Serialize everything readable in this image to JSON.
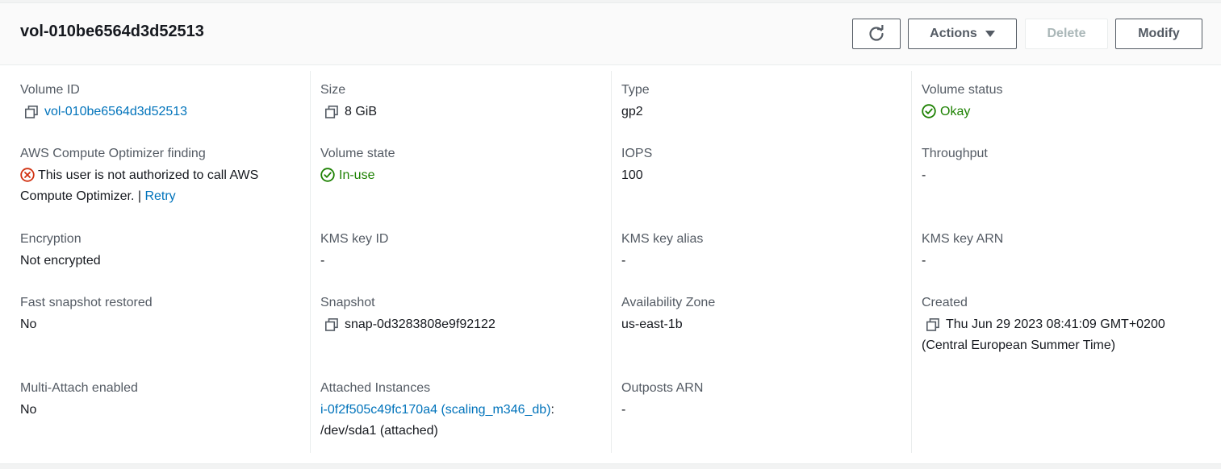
{
  "header": {
    "title": "vol-010be6564d3d52513",
    "actions_label": "Actions",
    "delete_label": "Delete",
    "modify_label": "Modify"
  },
  "details": {
    "volume_id": {
      "label": "Volume ID",
      "value": "vol-010be6564d3d52513"
    },
    "size": {
      "label": "Size",
      "value": "8 GiB"
    },
    "type": {
      "label": "Type",
      "value": "gp2"
    },
    "volume_status": {
      "label": "Volume status",
      "value": "Okay"
    },
    "optimizer": {
      "label": "AWS Compute Optimizer finding",
      "error_line1": "This user is not authorized to call AWS",
      "error_line2": "Compute Optimizer. |",
      "retry": "Retry"
    },
    "volume_state": {
      "label": "Volume state",
      "value": "In-use"
    },
    "iops": {
      "label": "IOPS",
      "value": "100"
    },
    "throughput": {
      "label": "Throughput",
      "value": "-"
    },
    "encryption": {
      "label": "Encryption",
      "value": "Not encrypted"
    },
    "kms_key_id": {
      "label": "KMS key ID",
      "value": "-"
    },
    "kms_key_alias": {
      "label": "KMS key alias",
      "value": "-"
    },
    "kms_key_arn": {
      "label": "KMS key ARN",
      "value": "-"
    },
    "fast_snapshot": {
      "label": "Fast snapshot restored",
      "value": "No"
    },
    "snapshot": {
      "label": "Snapshot",
      "value": "snap-0d3283808e9f92122"
    },
    "availability_zone": {
      "label": "Availability Zone",
      "value": "us-east-1b"
    },
    "created": {
      "label": "Created",
      "value_line1": "Thu Jun 29 2023 08:41:09 GMT+0200",
      "value_line2": "(Central European Summer Time)"
    },
    "multi_attach": {
      "label": "Multi-Attach enabled",
      "value": "No"
    },
    "attached_instances": {
      "label": "Attached Instances",
      "instance_link": "i-0f2f505c49fc170a4 (scaling_m346_db)",
      "separator": ":",
      "device": "/dev/sda1 (attached)"
    },
    "outposts_arn": {
      "label": "Outposts ARN",
      "value": "-"
    }
  },
  "colors": {
    "link": "#0073bb",
    "success": "#1d8102",
    "error": "#d13212"
  },
  "icons": {
    "refresh": "refresh-icon",
    "copy": "copy-icon",
    "status_ok": "check-circle-icon",
    "status_error": "x-circle-icon",
    "dropdown": "caret-down-icon"
  }
}
